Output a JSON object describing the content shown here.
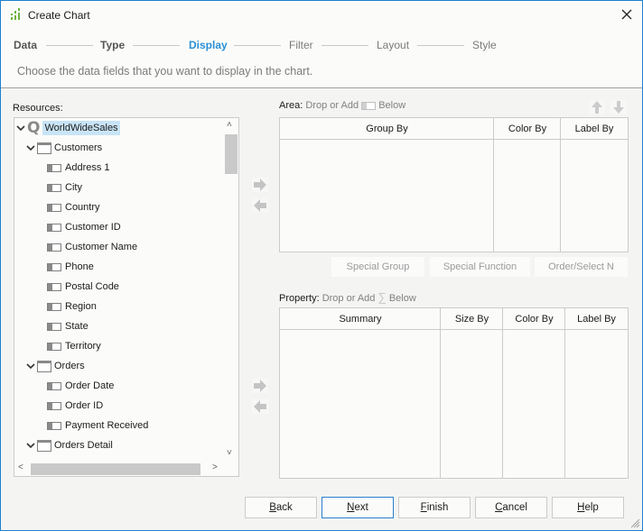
{
  "window": {
    "title": "Create Chart",
    "icon": "chart-app-icon",
    "close_icon": "close-icon"
  },
  "wizard": {
    "steps": [
      {
        "label": "Data",
        "state": "done"
      },
      {
        "label": "Type",
        "state": "done"
      },
      {
        "label": "Display",
        "state": "active"
      },
      {
        "label": "Filter",
        "state": "future"
      },
      {
        "label": "Layout",
        "state": "future"
      },
      {
        "label": "Style",
        "state": "future"
      }
    ],
    "instruction": "Choose the data fields that you want to display in the chart.",
    "active_color": "#2a8fd6"
  },
  "resources": {
    "label": "Resources:",
    "tree": [
      {
        "label": "WorldWideSales",
        "type": "query",
        "level": 0,
        "expanded": true,
        "selected": true
      },
      {
        "label": "Customers",
        "type": "table",
        "level": 1,
        "expanded": true
      },
      {
        "label": "Address 1",
        "type": "field",
        "level": 2
      },
      {
        "label": "City",
        "type": "field",
        "level": 2
      },
      {
        "label": "Country",
        "type": "field",
        "level": 2
      },
      {
        "label": "Customer ID",
        "type": "field",
        "level": 2
      },
      {
        "label": "Customer Name",
        "type": "field",
        "level": 2
      },
      {
        "label": "Phone",
        "type": "field",
        "level": 2
      },
      {
        "label": "Postal Code",
        "type": "field",
        "level": 2
      },
      {
        "label": "Region",
        "type": "field",
        "level": 2
      },
      {
        "label": "State",
        "type": "field",
        "level": 2
      },
      {
        "label": "Territory",
        "type": "field",
        "level": 2
      },
      {
        "label": "Orders",
        "type": "table",
        "level": 1,
        "expanded": true
      },
      {
        "label": "Order Date",
        "type": "field",
        "level": 2
      },
      {
        "label": "Order ID",
        "type": "field",
        "level": 2
      },
      {
        "label": "Payment Received",
        "type": "field",
        "level": 2
      },
      {
        "label": "Orders Detail",
        "type": "table",
        "level": 1,
        "expanded": true
      }
    ],
    "selection_color": "#c8e4f6"
  },
  "area": {
    "label_bold": "Area:",
    "label_hint_pre": "Drop or Add",
    "label_hint_post": "Below",
    "columns": [
      "Group By",
      "Color By",
      "Label By"
    ],
    "buttons": [
      "Special Group",
      "Special Function",
      "Order/Select N"
    ]
  },
  "property": {
    "label_bold": "Property:",
    "label_hint_pre": "Drop or Add",
    "label_hint_post": "Below",
    "hint_icon": "∑",
    "columns": [
      "Summary",
      "Size By",
      "Color By",
      "Label By"
    ]
  },
  "footer": {
    "buttons": [
      {
        "label": "Back",
        "mnemonic": "B",
        "rest": "ack"
      },
      {
        "label": "Next",
        "mnemonic": "N",
        "rest": "ext",
        "default": true
      },
      {
        "label": "Finish",
        "mnemonic": "F",
        "rest": "inish"
      },
      {
        "label": "Cancel",
        "mnemonic": "C",
        "rest": "ancel"
      },
      {
        "label": "Help",
        "mnemonic": "H",
        "rest": "elp"
      }
    ]
  }
}
